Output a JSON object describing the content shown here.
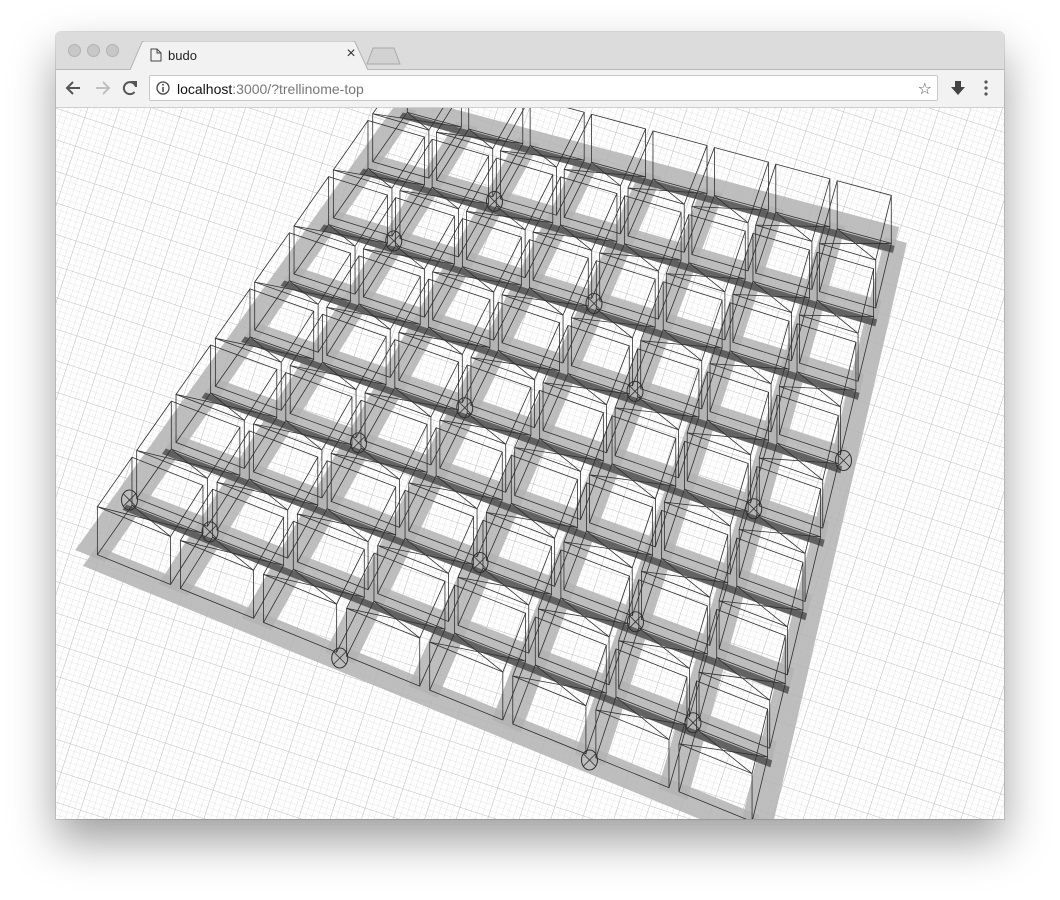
{
  "browser": {
    "tab_title": "budo",
    "tab_close": "×",
    "url_host": "localhost",
    "url_rest": ":3000/?trellinome-top",
    "bookmark_star": "☆"
  },
  "scene": {
    "description_icon": "wireframe-3d-grid",
    "colors": {
      "background": "#ffffff",
      "grid_line": "#c8c8c8",
      "wire": "#2f2f2f",
      "floor_band": "#b3b3b3",
      "dark_bar": "#444444"
    }
  }
}
